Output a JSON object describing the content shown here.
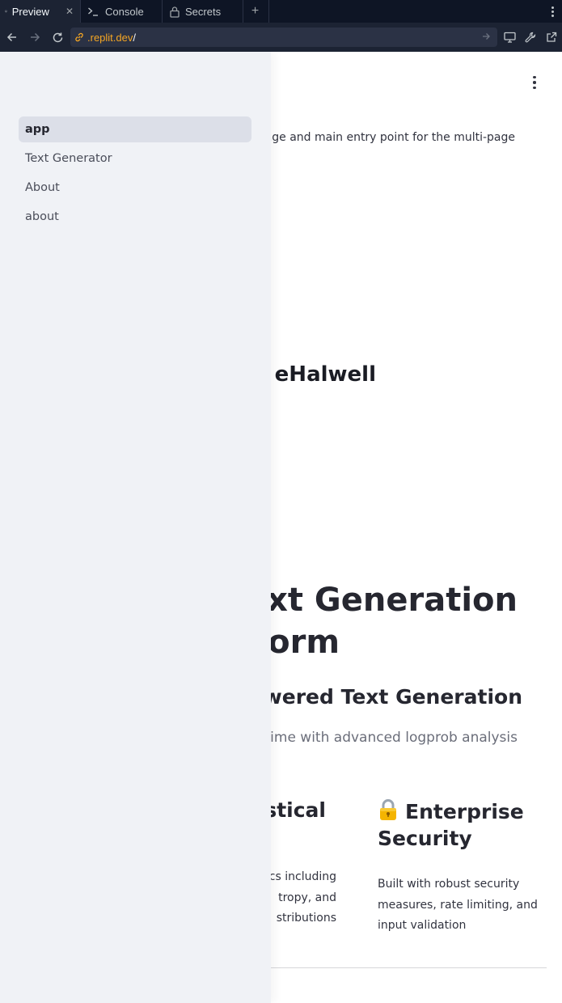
{
  "browser": {
    "tabs": [
      {
        "label": "Preview",
        "icon": "monitor-icon",
        "active": true
      },
      {
        "label": "Console",
        "icon": "terminal-icon",
        "active": false
      },
      {
        "label": "Secrets",
        "icon": "lock-icon",
        "active": false
      }
    ],
    "url": {
      "host": ".replit.dev",
      "path": "/"
    }
  },
  "sidebar": {
    "items": [
      {
        "label": "app",
        "active": true
      },
      {
        "label": "Text Generator",
        "active": false
      },
      {
        "label": "About",
        "active": false
      },
      {
        "label": "about",
        "active": false
      }
    ]
  },
  "main": {
    "intro_fragment": "epage and main entry point for the multi-page",
    "author_fragment": "eHalwell",
    "hero_line1": "Text Generation",
    "hero_line2": "form",
    "subheading_fragment": "l-Powered Text Generation",
    "tagline_fragment": "l-time with advanced logprob analysis",
    "features": {
      "left": {
        "title_fragment": "istical",
        "body_lines": [
          "cs including",
          "tropy, and",
          "stributions"
        ]
      },
      "right": {
        "icon": "lock-emoji",
        "title": "Enterprise Security",
        "body": "Built with robust security measures, rate limiting, and input validation"
      }
    }
  },
  "colors": {
    "chrome_bg": "#0e1525",
    "sidebar_bg": "#f0f2f6",
    "active_nav_bg": "#dcdfe8",
    "url_host": "#f5a623"
  }
}
